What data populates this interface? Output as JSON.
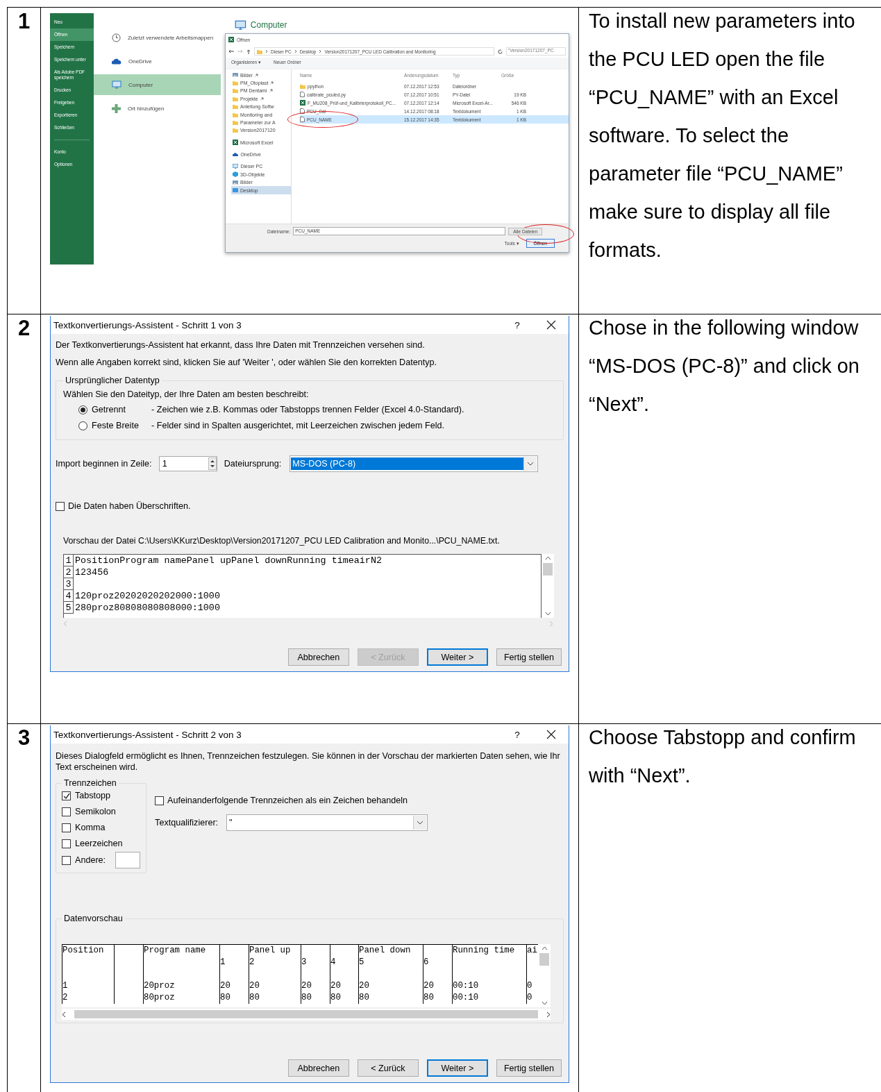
{
  "steps": [
    {
      "number": "1",
      "instruction": "To install new parameters into the PCU LED open the file “PCU_NAME” with an Excel software. To select the parameter file “PCU_NAME” make sure to display all file formats.",
      "screen": {
        "kind": "excel_open",
        "menu": [
          {
            "label": "Neu",
            "selected": false,
            "divider_before": false
          },
          {
            "label": "Öffnen",
            "selected": true,
            "divider_before": false
          },
          {
            "label": "Speichern",
            "selected": false,
            "divider_before": false
          },
          {
            "label": "Speichern unter",
            "selected": false,
            "divider_before": false
          },
          {
            "label": "Als Adobe PDF speichern",
            "selected": false,
            "divider_before": false
          },
          {
            "label": "Drucken",
            "selected": false,
            "divider_before": false
          },
          {
            "label": "Freigeben",
            "selected": false,
            "divider_before": false
          },
          {
            "label": "Exportieren",
            "selected": false,
            "divider_before": false
          },
          {
            "label": "Schließen",
            "selected": false,
            "divider_before": false
          },
          {
            "label": "Konto",
            "selected": false,
            "divider_before": true
          },
          {
            "label": "Optionen",
            "selected": false,
            "divider_before": false
          }
        ],
        "places": [
          {
            "label": "Zuletzt verwendete Arbeitsmappen",
            "kind": "clock",
            "selected": false
          },
          {
            "label": "OneDrive",
            "kind": "cloud",
            "selected": false
          },
          {
            "label": "Computer",
            "kind": "computer",
            "selected": true
          },
          {
            "label": "Ort hinzufügen",
            "kind": "plus",
            "selected": false
          }
        ],
        "location_title": "Computer",
        "dialog": {
          "title": "Öffnen",
          "breadcrumbs": [
            "Dieser PC",
            "Desktop",
            "Version20171207_PCU LED Calibration and Monitoring"
          ],
          "search_placeholder": "\"Version20171207_PC",
          "toolbar": [
            "Organisieren ▾",
            "Neuer Ordner"
          ],
          "nav": [
            {
              "label": "Bilder",
              "kind": "pictures",
              "pinned": true,
              "selected": false
            },
            {
              "label": "PM_Otoplast",
              "kind": "folder",
              "pinned": true,
              "selected": false
            },
            {
              "label": "PM Dentami",
              "kind": "folder",
              "pinned": true,
              "selected": false
            },
            {
              "label": "Projekte",
              "kind": "folder",
              "pinned": true,
              "selected": false
            },
            {
              "label": "Anleitung Softw",
              "kind": "folder",
              "pinned": false,
              "selected": false
            },
            {
              "label": "Monitoring and",
              "kind": "folder",
              "pinned": false,
              "selected": false
            },
            {
              "label": "Parameter zur A",
              "kind": "folder",
              "pinned": false,
              "selected": false
            },
            {
              "label": "Version2017120",
              "kind": "folder",
              "pinned": false,
              "selected": false
            },
            {
              "label": "Microsoft Excel",
              "kind": "excel",
              "pinned": false,
              "selected": false
            },
            {
              "label": "OneDrive",
              "kind": "cloud",
              "pinned": false,
              "selected": false
            },
            {
              "label": "Dieser PC",
              "kind": "computer",
              "pinned": false,
              "selected": false
            },
            {
              "label": "3D-Objekte",
              "kind": "cube",
              "pinned": false,
              "selected": false
            },
            {
              "label": "Bilder",
              "kind": "pictures",
              "pinned": false,
              "selected": false
            },
            {
              "label": "Desktop",
              "kind": "desktop",
              "pinned": false,
              "selected": true
            }
          ],
          "columns": [
            "Name",
            "Änderungsdatum",
            "Typ",
            "Größe"
          ],
          "files": [
            {
              "name": "ppython",
              "kind": "folder",
              "date": "07.12.2017 12:53",
              "type": "Dateiordner",
              "selected": false,
              "circled": false
            },
            {
              "name": "calibrate_pculed.py",
              "kind": "file",
              "date": "07.12.2017 10:51",
              "type": "PY-Datei",
              "size": "19 KB",
              "selected": false,
              "circled": false
            },
            {
              "name": "F_MU208_Prüf-und_Kalibrierprotokoll_PC...",
              "kind": "excel",
              "date": "07.12.2017 12:14",
              "type": "Microsoft Excel-Ar...",
              "size": "546 KB",
              "selected": false,
              "circled": false
            },
            {
              "name": "PCU_Cal",
              "kind": "file",
              "date": "14.12.2017 08:18",
              "type": "Textdokument",
              "size": "1 KB",
              "selected": false,
              "circled": false
            },
            {
              "name": "PCU_NAME",
              "kind": "file",
              "date": "15.12.2017 14:35",
              "type": "Textdokument",
              "size": "1 KB",
              "selected": true,
              "circled": true
            }
          ],
          "filename_label": "Dateiname:",
          "filename": "PCU_NAME",
          "filter": {
            "value": "Alle Dateien",
            "circled": true
          },
          "tools": "Tools ▾",
          "open_button": "Öffnen"
        }
      }
    },
    {
      "number": "2",
      "instruction": "Chose in the following window “MS-DOS (PC-8)” and click on “Next”.",
      "screen": {
        "kind": "wizard_step1",
        "title": "Textkonvertierungs-Assistent - Schritt 1 von 3",
        "help": "?",
        "intro": [
          "Der Textkonvertierungs-Assistent hat erkannt, dass Ihre Daten mit Trennzeichen versehen sind.",
          "Wenn alle Angaben korrekt sind, klicken Sie auf 'Weiter ', oder wählen Sie den korrekten Datentyp."
        ],
        "group_legend": "Ursprünglicher Datentyp",
        "group_prompt": "Wählen Sie den Dateityp, der Ihre Daten am besten beschreibt:",
        "radios": [
          {
            "label": "Getrennt",
            "description": "- Zeichen wie z.B. Kommas oder Tabstopps trennen Felder (Excel 4.0-Standard).",
            "selected": true
          },
          {
            "label": "Feste Breite",
            "description": "- Felder sind in Spalten ausgerichtet, mit Leerzeichen zwischen jedem Feld.",
            "selected": false
          }
        ],
        "start_row": {
          "label": "Import beginnen in Zeile:",
          "value": "1"
        },
        "origin": {
          "label": "Dateiursprung:",
          "value": "MS-DOS (PC-8)",
          "highlighted": true
        },
        "header_checkbox": {
          "label": "Die Daten haben Überschriften.",
          "checked": false
        },
        "preview_label": "Vorschau der Datei C:\\Users\\KKurz\\Desktop\\Version20171207_PCU LED Calibration and Monito...\\PCU_NAME.txt.",
        "preview_lines": [
          {
            "number": "1",
            "text": "PositionProgram namePanel upPanel downRunning timeairN2"
          },
          {
            "number": "2",
            "text": "123456"
          },
          {
            "number": "3"
          },
          {
            "number": "4",
            "text": "120proz20202020202000:1000"
          },
          {
            "number": "5",
            "text": "280proz80808080808000:1000"
          }
        ],
        "buttons": [
          {
            "label": "Abbrechen",
            "disabled": false,
            "default": false
          },
          {
            "label": "< Zurück",
            "disabled": true,
            "default": false
          },
          {
            "label": "Weiter >",
            "disabled": false,
            "default": true
          },
          {
            "label": "Fertig stellen",
            "disabled": false,
            "default": false
          }
        ]
      }
    },
    {
      "number": "3",
      "instruction": "Choose Tabstopp and confirm with “Next”.",
      "screen": {
        "kind": "wizard_step2",
        "title": "Textkonvertierungs-Assistent - Schritt 2 von 3",
        "help": "?",
        "intro": "Dieses Dialogfeld ermöglicht es Ihnen, Trennzeichen festzulegen. Sie können in der Vorschau der markierten Daten sehen, wie Ihr Text erscheinen wird.",
        "delimiters_legend": "Trennzeichen",
        "delimiters": [
          {
            "label": "Tabstopp",
            "checked": true,
            "kind": "plain"
          },
          {
            "label": "Semikolon",
            "checked": false,
            "kind": "plain"
          },
          {
            "label": "Komma",
            "checked": false,
            "kind": "plain"
          },
          {
            "label": "Leerzeichen",
            "checked": false,
            "kind": "plain"
          },
          {
            "label": "Andere:",
            "checked": false,
            "kind": "other"
          }
        ],
        "consecutive": {
          "label": "Aufeinanderfolgende Trennzeichen als ein Zeichen behandeln",
          "checked": false
        },
        "qualifier": {
          "label": "Textqualifizierer:",
          "value": "\""
        },
        "preview_legend": "Datenvorschau",
        "preview_rows": [
          [
            "Position",
            null,
            "Program name",
            null,
            "Panel up",
            null,
            null,
            "Panel down",
            null,
            "Running time",
            "ai"
          ],
          [
            null,
            null,
            null,
            "1",
            "2",
            "3",
            "4",
            "5",
            "6",
            null,
            null
          ],
          [
            null,
            null,
            null,
            null,
            null,
            null,
            null,
            null,
            null,
            null,
            null
          ],
          [
            "1",
            null,
            "20proz",
            "20",
            "20",
            "20",
            "20",
            "20",
            "20",
            "00:10",
            "0"
          ],
          [
            "2",
            null,
            "80proz",
            "80",
            "80",
            "80",
            "80",
            "80",
            "80",
            "00:10",
            "0"
          ]
        ],
        "buttons": [
          {
            "label": "Abbrechen",
            "disabled": false,
            "default": false
          },
          {
            "label": "< Zurück",
            "disabled": false,
            "default": false
          },
          {
            "label": "Weiter >",
            "disabled": false,
            "default": true
          },
          {
            "label": "Fertig stellen",
            "disabled": false,
            "default": false
          }
        ]
      }
    }
  ]
}
